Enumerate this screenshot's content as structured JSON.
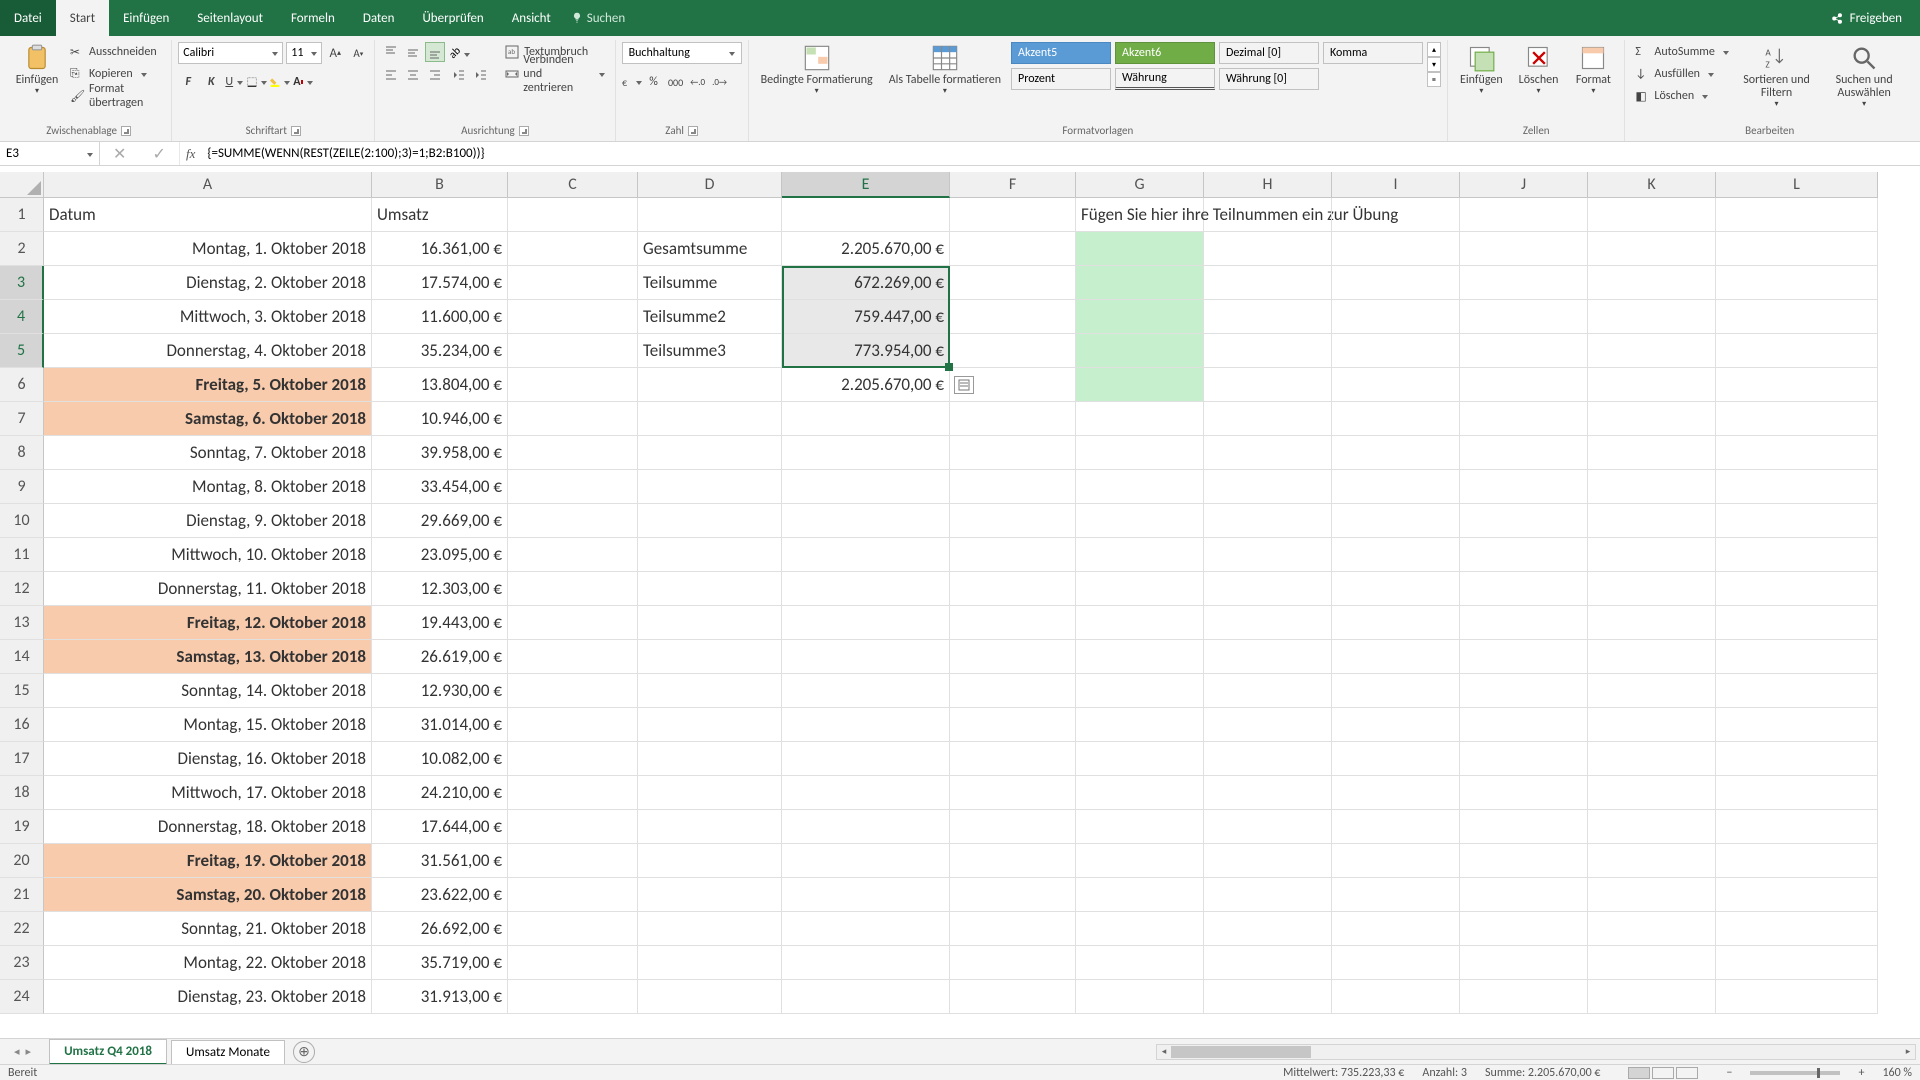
{
  "titlebar": {
    "file": "Datei",
    "tabs": [
      "Start",
      "Einfügen",
      "Seitenlayout",
      "Formeln",
      "Daten",
      "Überprüfen",
      "Ansicht"
    ],
    "active_tab": "Start",
    "tellme": "Suchen",
    "share": "Freigeben"
  },
  "ribbon": {
    "clipboard": {
      "paste": "Einfügen",
      "cut": "Ausschneiden",
      "copy": "Kopieren",
      "format_painter": "Format übertragen",
      "label": "Zwischenablage"
    },
    "font": {
      "family": "Calibri",
      "size": "11",
      "bold": "F",
      "italic": "K",
      "underline": "U",
      "label": "Schriftart"
    },
    "alignment": {
      "wrap": "Textumbruch",
      "merge": "Verbinden und zentrieren",
      "label": "Ausrichtung"
    },
    "number": {
      "format": "Buchhaltung",
      "label": "Zahl"
    },
    "styles": {
      "cond": "Bedingte Formatierung",
      "table": "Als Tabelle formatieren",
      "akzent5": "Akzent5",
      "akzent6": "Akzent6",
      "dezimal": "Dezimal [0]",
      "komma": "Komma",
      "prozent": "Prozent",
      "waehrung": "Währung",
      "waehrung0": "Währung [0]",
      "label": "Formatvorlagen"
    },
    "cells": {
      "insert": "Einfügen",
      "delete": "Löschen",
      "format": "Format",
      "label": "Zellen"
    },
    "editing": {
      "autosum": "AutoSumme",
      "fill": "Ausfüllen",
      "clear": "Löschen",
      "sort": "Sortieren und Filtern",
      "find": "Suchen und Auswählen",
      "label": "Bearbeiten"
    }
  },
  "name_box": "E3",
  "formula": "{=SUMME(WENN(REST(ZEILE(2:100);3)=1;B2:B100))}",
  "columns": [
    "A",
    "B",
    "C",
    "D",
    "E",
    "F",
    "G",
    "H",
    "I",
    "J",
    "K",
    "L"
  ],
  "headers": {
    "A1": "Datum",
    "B1": "Umsatz",
    "G1": "Fügen Sie hier ihre Teilnummen ein zur Übung"
  },
  "dates": [
    "Montag, 1. Oktober 2018",
    "Dienstag, 2. Oktober 2018",
    "Mittwoch, 3. Oktober 2018",
    "Donnerstag, 4. Oktober 2018",
    "Freitag, 5. Oktober 2018",
    "Samstag, 6. Oktober 2018",
    "Sonntag, 7. Oktober 2018",
    "Montag, 8. Oktober 2018",
    "Dienstag, 9. Oktober 2018",
    "Mittwoch, 10. Oktober 2018",
    "Donnerstag, 11. Oktober 2018",
    "Freitag, 12. Oktober 2018",
    "Samstag, 13. Oktober 2018",
    "Sonntag, 14. Oktober 2018",
    "Montag, 15. Oktober 2018",
    "Dienstag, 16. Oktober 2018",
    "Mittwoch, 17. Oktober 2018",
    "Donnerstag, 18. Oktober 2018",
    "Freitag, 19. Oktober 2018",
    "Samstag, 20. Oktober 2018",
    "Sonntag, 21. Oktober 2018",
    "Montag, 22. Oktober 2018",
    "Dienstag, 23. Oktober 2018"
  ],
  "umsatz": [
    "16.361,00 €",
    "17.574,00 €",
    "11.600,00 €",
    "35.234,00 €",
    "13.804,00 €",
    "10.946,00 €",
    "39.958,00 €",
    "33.454,00 €",
    "29.669,00 €",
    "23.095,00 €",
    "12.303,00 €",
    "19.443,00 €",
    "26.619,00 €",
    "12.930,00 €",
    "31.014,00 €",
    "10.082,00 €",
    "24.210,00 €",
    "17.644,00 €",
    "31.561,00 €",
    "23.622,00 €",
    "26.692,00 €",
    "35.719,00 €",
    "31.913,00 €"
  ],
  "weekend_rows": [
    6,
    7,
    13,
    14,
    20,
    21
  ],
  "sum_labels": [
    "Gesamtsumme",
    "Teilsumme",
    "Teilsumme2",
    "Teilsumme3"
  ],
  "sum_values": [
    "2.205.670,00 €",
    "672.269,00 €",
    "759.447,00 €",
    "773.954,00 €",
    "2.205.670,00 €"
  ],
  "sheets": {
    "tabs": [
      "Umsatz Q4 2018",
      "Umsatz Monate"
    ],
    "active": "Umsatz Q4 2018"
  },
  "status": {
    "ready": "Bereit",
    "avg_label": "Mittelwert:",
    "avg": "735.223,33 €",
    "count_label": "Anzahl:",
    "count": "3",
    "sum_label": "Summe:",
    "sum": "2.205.670,00 €",
    "zoom": "160 %"
  }
}
